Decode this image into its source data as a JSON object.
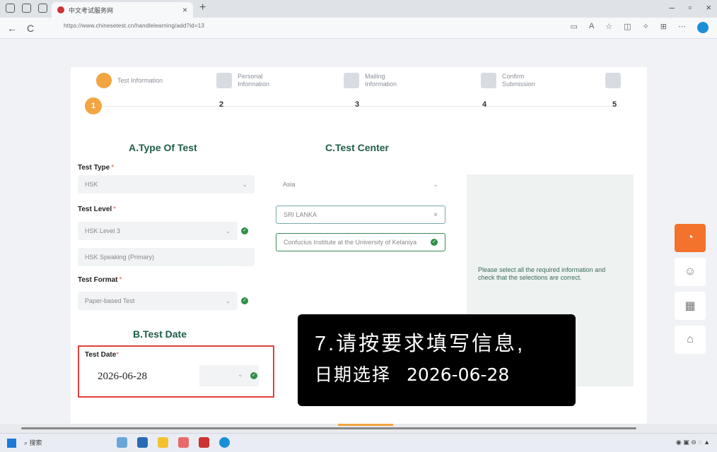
{
  "browser": {
    "tab_title": "中文考试服务网",
    "tab_close": "×",
    "new_tab": "+",
    "url": "https://www.chinesetest.cn/handlelearning/add?id=13",
    "nav": {
      "back": "←",
      "refresh": "C"
    },
    "window_controls": {
      "minimize": "–",
      "maximize": "▫",
      "close": "×"
    }
  },
  "steps": [
    {
      "label": "Test Information",
      "number": "1",
      "active": true
    },
    {
      "label": "Personal Information",
      "number": "2",
      "active": false
    },
    {
      "label": "Mailing Information",
      "number": "3",
      "active": false
    },
    {
      "label": "Confirm Submission",
      "number": "4",
      "active": false
    },
    {
      "label": "",
      "number": "5",
      "active": false
    }
  ],
  "section_a": {
    "title": "A.Type Of Test",
    "test_type": {
      "label": "Test Type",
      "value": "HSK"
    },
    "test_level": {
      "label": "Test Level",
      "value": "HSK Level 3",
      "sub_value": "HSK Speaking (Primary)"
    },
    "test_format": {
      "label": "Test Format",
      "value": "Paper-based Test"
    }
  },
  "section_b": {
    "title": "B.Test Date",
    "test_date": {
      "label": "Test Date",
      "value": "2026-06-28"
    }
  },
  "section_c": {
    "title": "C.Test Center",
    "region": "Asia",
    "country": "SRI LANKA",
    "center": "Confucius Institute at the University of Kelaniya"
  },
  "notice": "Please select all the required information and check that the selections are correct.",
  "instruction": {
    "line1": "7.请按要求填写信息,",
    "line2": "日期选择",
    "line2_date": "2026-06-28"
  },
  "taskbar": {
    "search": "搜索"
  },
  "colors": {
    "accent": "#f2a541",
    "section_title": "#1d5c4a",
    "highlight": "#e2403a",
    "float_hot": "#f3722c"
  }
}
